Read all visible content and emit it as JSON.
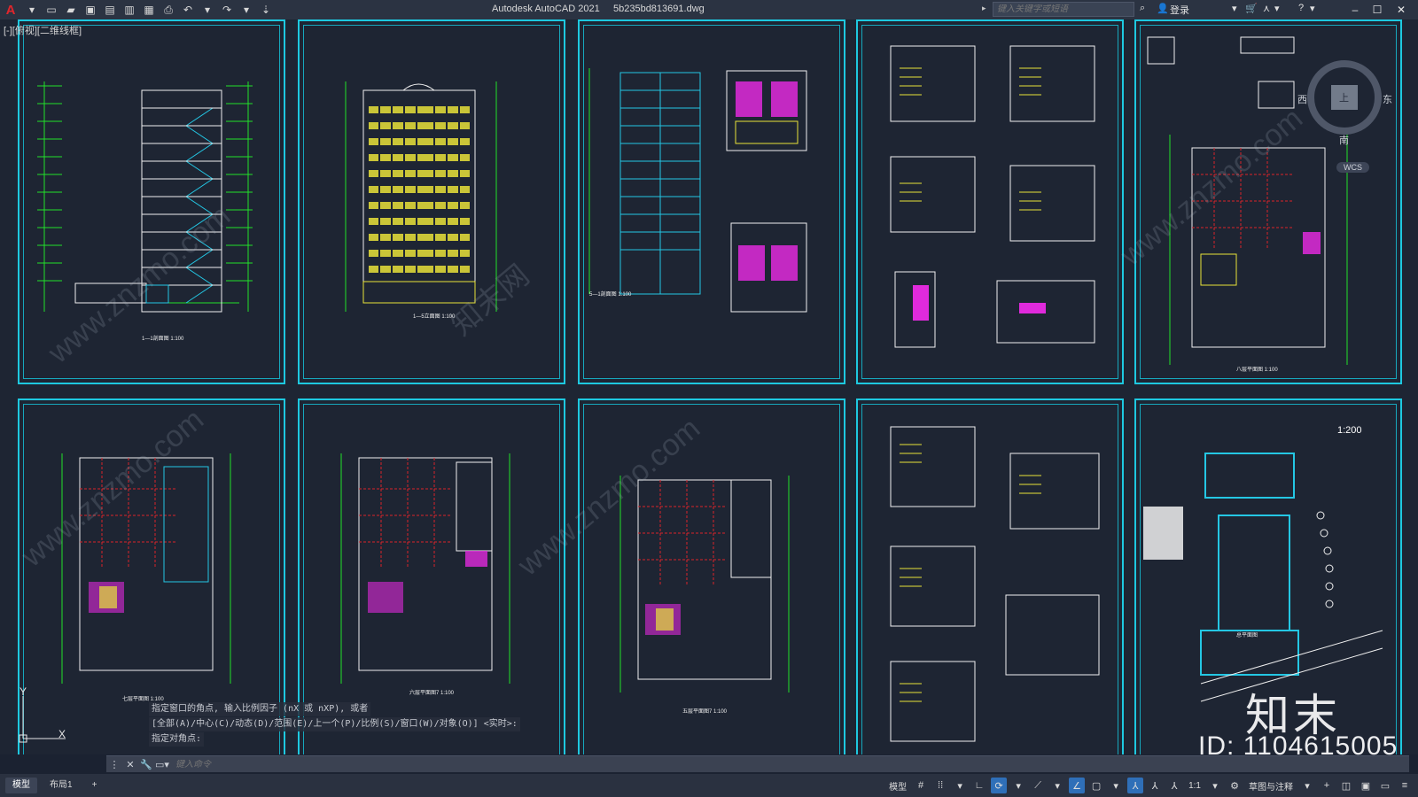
{
  "titlebar": {
    "app_logo": "A",
    "app_name": "Autodesk AutoCAD 2021",
    "file_name": "5b235bd813691.dwg",
    "search_placeholder": "键入关键字或短语",
    "login_label": "登录"
  },
  "viewport": {
    "label": "[-][俯视][二维线框]"
  },
  "sheets": {
    "elevation_title_1": "1—1剖面图 1:100",
    "elevation_title_2": "1—5立面图 1:100",
    "section_title": "5—1剖面图 1:100",
    "plan_title_1": "七层平面图  1:100",
    "plan_title_2": "六层平面图7  1:100",
    "plan_title_3": "五层平面图7  1:100",
    "plan_title_4": "八层平面图  1:100",
    "site_scale": "1:200",
    "site_label": "总平面图"
  },
  "command": {
    "line1": "指定窗口的角点, 输入比例因子 (nX 或 nXP), 或者",
    "line2": "[全部(A)/中心(C)/动态(D)/范围(E)/上一个(P)/比例(S)/窗口(W)/对象(O)] <实时>:",
    "line3": "指定对角点:",
    "input_placeholder": "键入命令"
  },
  "statusbar": {
    "tab_model": "模型",
    "tab_layout1": "布局1",
    "add_tab": "+",
    "model_label": "模型",
    "scale": "1:1",
    "annotation": "草图与注释"
  },
  "viewcube": {
    "west": "西",
    "east": "东",
    "south": "南",
    "top": "上",
    "wcs": "WCS"
  },
  "watermark": {
    "id_text": "ID: 1104615005",
    "logo_text": "知末",
    "diagonal_text": "www.znzmo.com",
    "diagonal_cn": "知末网"
  },
  "ucs": {
    "y": "Y",
    "x": "X"
  },
  "colors": {
    "sheet_border": "#1ec9e0",
    "background": "#1e2533",
    "line_green": "#22e12a",
    "line_yellow": "#e8e23a",
    "line_red": "#d9242a",
    "line_magenta": "#e02adc",
    "line_cyan": "#24c7e4",
    "line_white": "#f0f0f0"
  }
}
